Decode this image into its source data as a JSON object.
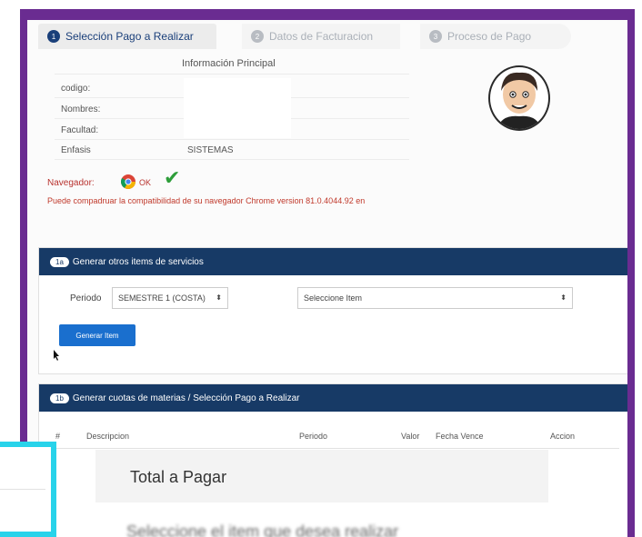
{
  "tabs": [
    {
      "num": "1",
      "label": "Selección Pago a Realizar"
    },
    {
      "num": "2",
      "label": "Datos de Facturacion"
    },
    {
      "num": "3",
      "label": "Proceso de Pago"
    }
  ],
  "info": {
    "title": "Información Principal",
    "codigo_label": "codigo:",
    "nombres_label": "Nombres:",
    "facultad_label": "Facultad:",
    "enfasis_label": "Enfasis",
    "enfasis_value": "SISTEMAS"
  },
  "browser": {
    "label": "Navegador:",
    "ok": "OK",
    "compat_text": "Puede compadruar la compatibilidad de su navegador Chrome version 81.0.4044.92 en"
  },
  "panel1": {
    "badge": "1a",
    "title": "Generar otros items de servicios",
    "periodo_label": "Periodo",
    "periodo_value": "SEMESTRE 1 (COSTA)",
    "item_placeholder": "Seleccione Item",
    "button": "Generar Item"
  },
  "panel2": {
    "badge": "1b",
    "title": "Generar cuotas de materias / Selección Pago a Realizar",
    "headers": [
      "#",
      "Descripcion",
      "Periodo",
      "Valor",
      "Fecha Vence",
      "Accion"
    ],
    "total_label": "Total a Pagar",
    "footer_text": "Seleccione el item que desea realizar"
  },
  "colors": {
    "frame": "#6a2c91",
    "panel_header": "#173a66",
    "button": "#1a6fce",
    "overlay": "#28d3ea"
  }
}
